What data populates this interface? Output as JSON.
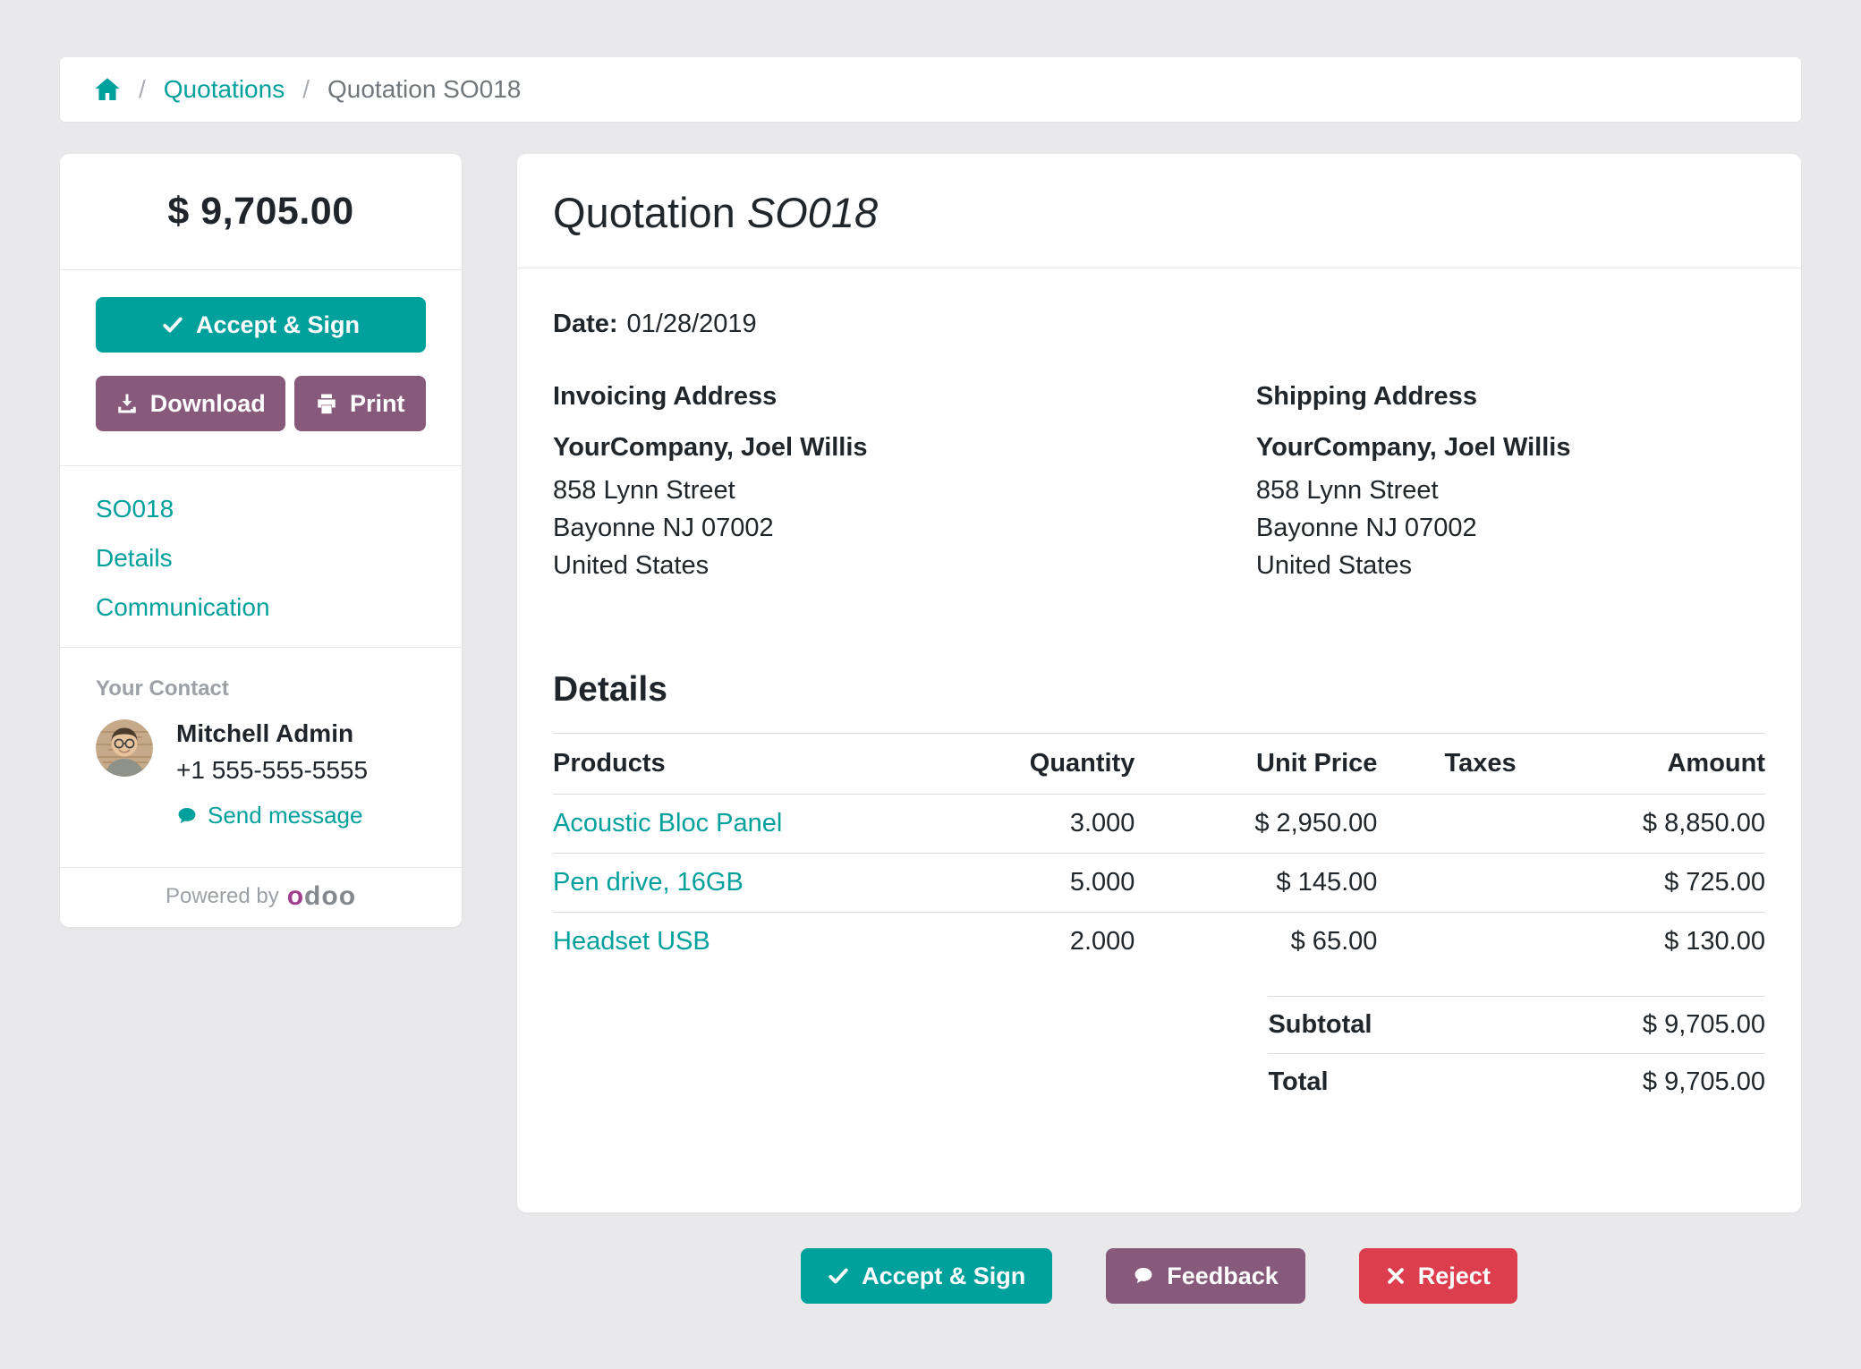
{
  "colors": {
    "accent_teal": "#00a09d",
    "mauve": "#875a7b",
    "danger_red": "#dc3e4d",
    "page_background": "#e9e9eb",
    "odoo_magenta": "#a13d8d"
  },
  "breadcrumb": {
    "items": [
      {
        "label": "Quotations"
      },
      {
        "label": "Quotation SO018"
      }
    ]
  },
  "sidebar": {
    "amount": "$ 9,705.00",
    "accept_label": "Accept & Sign",
    "download_label": "Download",
    "print_label": "Print",
    "nav_links": [
      "SO018",
      "Details",
      "Communication"
    ],
    "contact": {
      "heading": "Your Contact",
      "name": "Mitchell Admin",
      "phone": "+1 555-555-5555",
      "send_message": "Send message"
    },
    "powered_by": {
      "prefix": "Powered by",
      "brand_first": "o",
      "brand_rest": "doo"
    }
  },
  "main": {
    "title_prefix": "Quotation ",
    "title_ref": "SO018",
    "date_label": "Date:",
    "date_value": "01/28/2019",
    "invoicing": {
      "heading": "Invoicing Address",
      "name": "YourCompany, Joel Willis",
      "lines": [
        "858 Lynn Street",
        "Bayonne NJ 07002",
        "United States"
      ]
    },
    "shipping": {
      "heading": "Shipping Address",
      "name": "YourCompany, Joel Willis",
      "lines": [
        "858 Lynn Street",
        "Bayonne NJ 07002",
        "United States"
      ]
    },
    "details_heading": "Details",
    "table": {
      "headers": [
        "Products",
        "Quantity",
        "Unit Price",
        "Taxes",
        "Amount"
      ],
      "rows": [
        {
          "product": "Acoustic Bloc Panel",
          "quantity": "3.000",
          "unit_price": "$ 2,950.00",
          "taxes": "",
          "amount": "$ 8,850.00"
        },
        {
          "product": "Pen drive, 16GB",
          "quantity": "5.000",
          "unit_price": "$ 145.00",
          "taxes": "",
          "amount": "$ 725.00"
        },
        {
          "product": "Headset USB",
          "quantity": "2.000",
          "unit_price": "$ 65.00",
          "taxes": "",
          "amount": "$ 130.00"
        }
      ],
      "totals": [
        {
          "label": "Subtotal",
          "value": "$ 9,705.00"
        },
        {
          "label": "Total",
          "value": "$ 9,705.00"
        }
      ]
    }
  },
  "footer": {
    "actions": [
      {
        "label": "Accept & Sign"
      },
      {
        "label": "Feedback"
      },
      {
        "label": "Reject"
      }
    ]
  }
}
